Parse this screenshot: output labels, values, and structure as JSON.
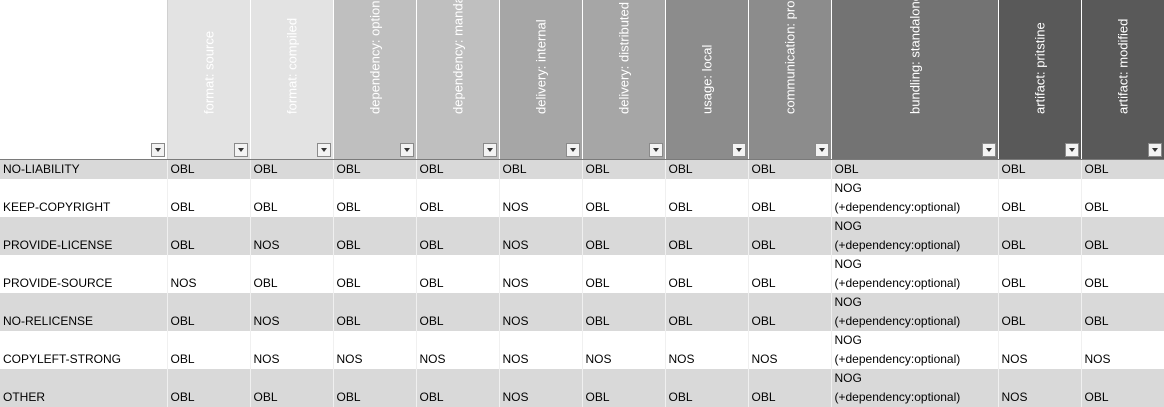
{
  "headers": [
    {
      "label": "format: source",
      "bg": "#e3e3e3"
    },
    {
      "label": "format: compiled",
      "bg": "#e3e3e3"
    },
    {
      "label": "dependency: optional",
      "bg": "#bfbfbf"
    },
    {
      "label": "dependency: mandatory",
      "bg": "#bfbfbf"
    },
    {
      "label": "delivery: internal",
      "bg": "#a6a6a6"
    },
    {
      "label": "delivery: distributed",
      "bg": "#a6a6a6"
    },
    {
      "label": "usage: local",
      "bg": "#8c8c8c"
    },
    {
      "label": "communication: process",
      "bg": "#8c8c8c"
    },
    {
      "label": "bundling: standalone",
      "bg": "#737373"
    },
    {
      "label": "artifact: pritstine",
      "bg": "#595959"
    },
    {
      "label": "artifact: modified",
      "bg": "#595959"
    }
  ],
  "rows": [
    {
      "name": "NO-LIABILITY",
      "cells": [
        "OBL",
        "OBL",
        "OBL",
        "OBL",
        "OBL",
        "OBL",
        "OBL",
        "OBL",
        [
          "OBL"
        ],
        "OBL",
        "OBL"
      ]
    },
    {
      "name": "KEEP-COPYRIGHT",
      "cells": [
        "OBL",
        "OBL",
        "OBL",
        "OBL",
        "NOS",
        "OBL",
        "OBL",
        "OBL",
        [
          "NOG",
          "(+dependency:optional)"
        ],
        "OBL",
        "OBL"
      ]
    },
    {
      "name": "PROVIDE-LICENSE",
      "cells": [
        "OBL",
        "NOS",
        "OBL",
        "OBL",
        "NOS",
        "OBL",
        "OBL",
        "OBL",
        [
          "NOG",
          "(+dependency:optional)"
        ],
        "OBL",
        "OBL"
      ]
    },
    {
      "name": "PROVIDE-SOURCE",
      "cells": [
        "NOS",
        "OBL",
        "OBL",
        "OBL",
        "NOS",
        "OBL",
        "OBL",
        "OBL",
        [
          "NOG",
          "(+dependency:optional)"
        ],
        "OBL",
        "OBL"
      ]
    },
    {
      "name": "NO-RELICENSE",
      "cells": [
        "OBL",
        "NOS",
        "OBL",
        "OBL",
        "NOS",
        "OBL",
        "OBL",
        "OBL",
        [
          "NOG",
          "(+dependency:optional)"
        ],
        "OBL",
        "OBL"
      ]
    },
    {
      "name": "COPYLEFT-STRONG",
      "cells": [
        "OBL",
        "NOS",
        "NOS",
        "NOS",
        "NOS",
        "NOS",
        "NOS",
        "NOS",
        [
          "NOG",
          "(+dependency:optional)"
        ],
        "NOS",
        "NOS"
      ]
    },
    {
      "name": "OTHER",
      "cells": [
        "OBL",
        "OBL",
        "OBL",
        "OBL",
        "NOS",
        "OBL",
        "OBL",
        "OBL",
        [
          "NOG",
          "(+dependency:optional)"
        ],
        "NOS",
        "OBL"
      ]
    }
  ]
}
